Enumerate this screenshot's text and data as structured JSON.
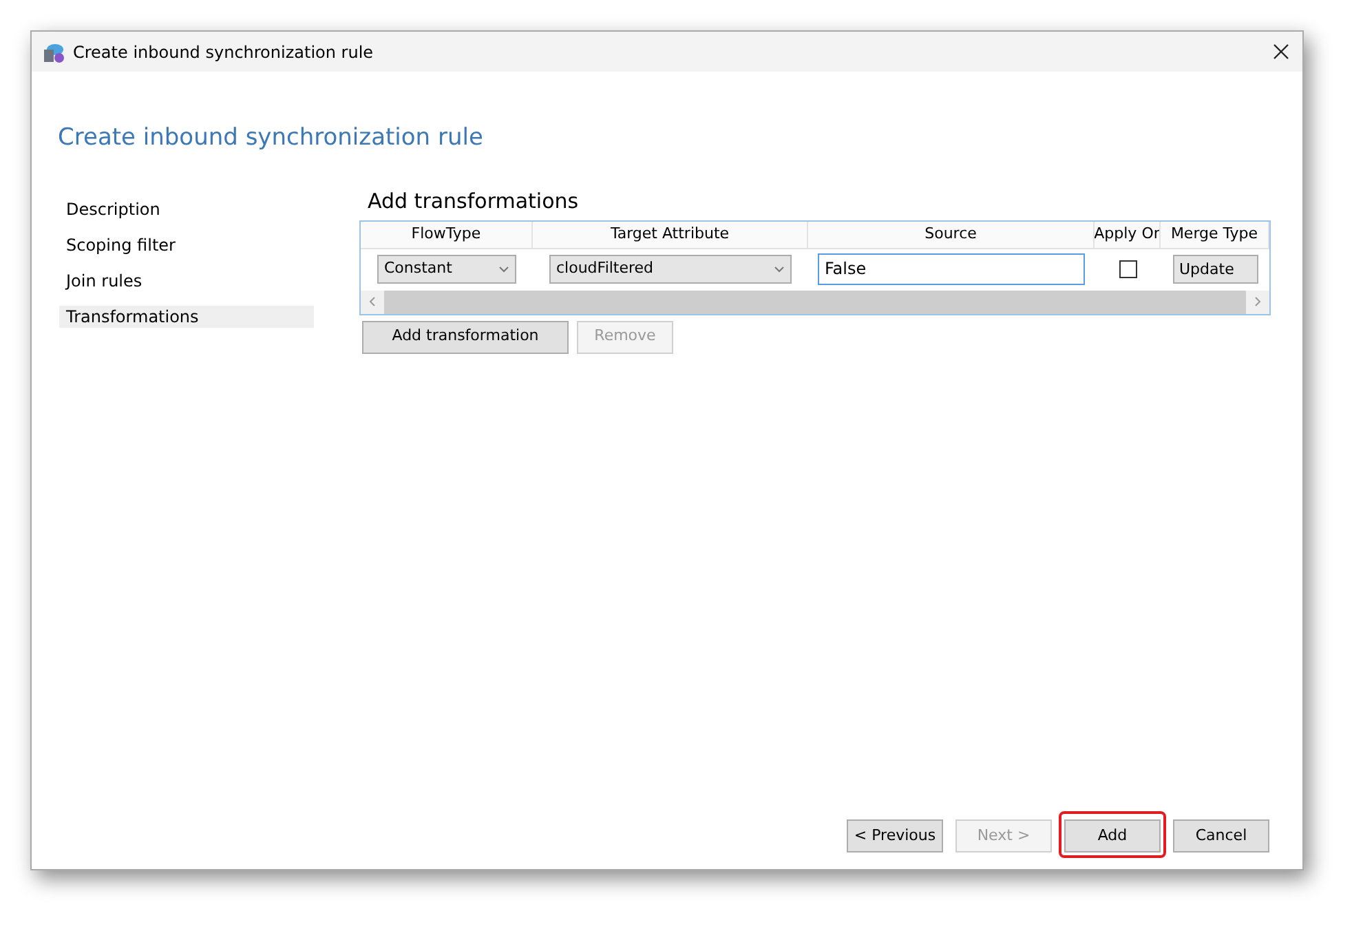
{
  "window": {
    "title": "Create inbound synchronization rule"
  },
  "heading": "Create inbound synchronization rule",
  "sidebar": {
    "items": [
      {
        "label": "Description",
        "selected": false
      },
      {
        "label": "Scoping filter",
        "selected": false
      },
      {
        "label": "Join rules",
        "selected": false
      },
      {
        "label": "Transformations",
        "selected": true
      }
    ]
  },
  "section_title": "Add transformations",
  "table": {
    "columns": [
      "FlowType",
      "Target Attribute",
      "Source",
      "Apply Or",
      "Merge Type"
    ],
    "rows": [
      {
        "cells": [
          {
            "kind": "dropdown",
            "value": "Constant"
          },
          {
            "kind": "dropdown",
            "value": "cloudFiltered"
          },
          {
            "kind": "text",
            "value": "False"
          },
          {
            "kind": "checkbox",
            "checked": false
          },
          {
            "kind": "box",
            "value": "Update"
          }
        ]
      }
    ]
  },
  "table_buttons": [
    {
      "label": "Add transformation",
      "disabled": false
    },
    {
      "label": "Remove",
      "disabled": true
    }
  ],
  "footer_buttons": [
    {
      "label": "< Previous",
      "disabled": false,
      "highlighted": false
    },
    {
      "label": "Next >",
      "disabled": true,
      "highlighted": false
    },
    {
      "label": "Add",
      "disabled": false,
      "highlighted": true
    },
    {
      "label": "Cancel",
      "disabled": false,
      "highlighted": false
    }
  ]
}
